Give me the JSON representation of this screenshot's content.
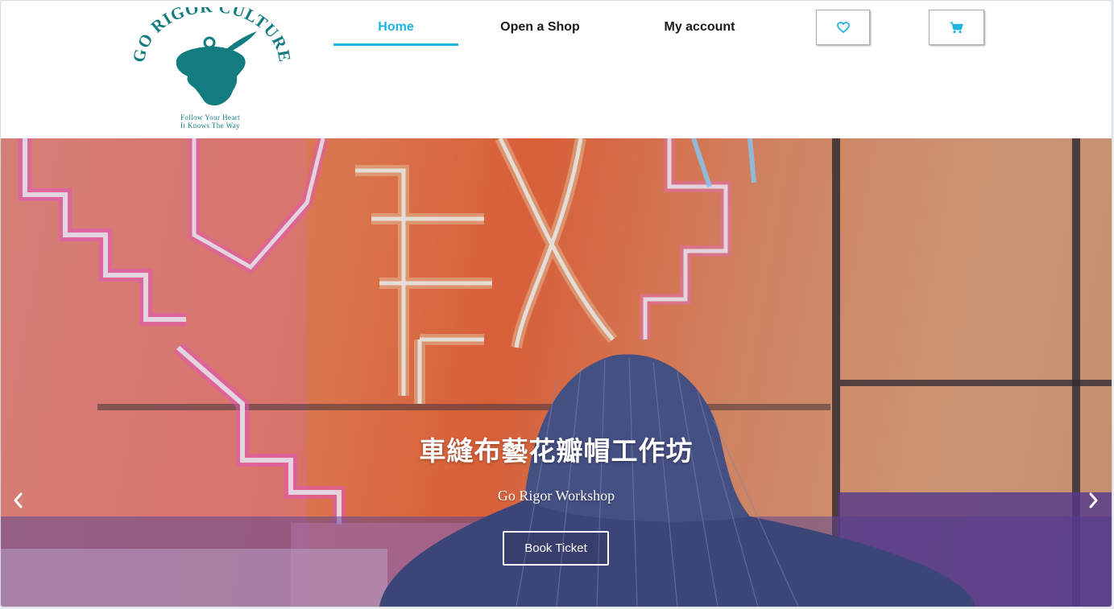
{
  "logo": {
    "brand": "GO RIGOR CULTURE",
    "tagline_1": "Follow Your Heart",
    "tagline_2": "It Knows The Way"
  },
  "nav": {
    "items": [
      {
        "label": "Home",
        "active": true
      },
      {
        "label": "Open a Shop",
        "active": false
      },
      {
        "label": "My account",
        "active": false
      }
    ]
  },
  "icons": {
    "wishlist": "heart-icon",
    "cart": "cart-icon",
    "prev": "chevron-left-icon",
    "next": "chevron-right-icon"
  },
  "hero": {
    "title": "車縫布藝花瓣帽工作坊",
    "subtitle": "Go Rigor Workshop",
    "cta_label": "Book Ticket"
  },
  "colors": {
    "accent": "#1fb3e0",
    "brand_teal": "#137c80",
    "text_dark": "#1a1a1a"
  }
}
